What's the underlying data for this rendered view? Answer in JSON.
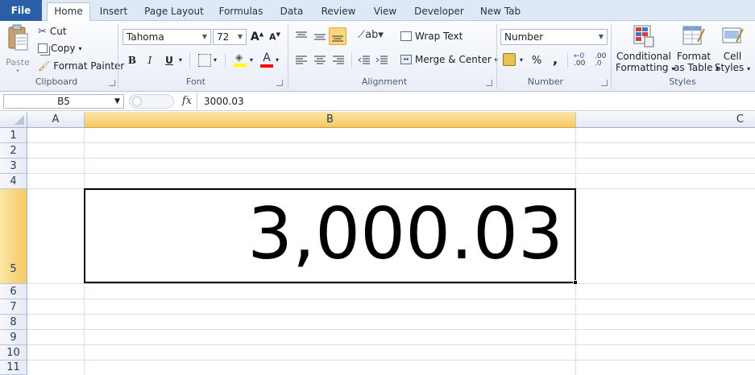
{
  "tabs": {
    "file": "File",
    "items": [
      "Home",
      "Insert",
      "Page Layout",
      "Formulas",
      "Data",
      "Review",
      "View",
      "Developer",
      "New Tab"
    ]
  },
  "clipboard": {
    "paste": "Paste",
    "cut": "Cut",
    "copy": "Copy",
    "format_painter": "Format Painter",
    "group_label": "Clipboard"
  },
  "font": {
    "name": "Tahoma",
    "size": "72",
    "bold": "B",
    "italic": "I",
    "underline": "U",
    "font_color_letter": "A",
    "group_label": "Font"
  },
  "alignment": {
    "wrap_text": "Wrap Text",
    "merge_center": "Merge & Center",
    "group_label": "Alignment"
  },
  "number": {
    "format": "Number",
    "percent": "%",
    "comma": ",",
    "inc_decimal": ".00",
    "dec_decimal": ".0",
    "group_label": "Number"
  },
  "styles": {
    "conditional_1": "Conditional",
    "conditional_2": "Formatting",
    "format_table_1": "Format",
    "format_table_2": "as Table",
    "cell_styles_1": "Cell",
    "cell_styles_2": "Styles",
    "group_label": "Styles"
  },
  "formula_bar": {
    "name_box": "B5",
    "fx": "fx",
    "value": "3000.03"
  },
  "grid": {
    "columns": [
      "A",
      "B",
      "C"
    ],
    "rows": [
      "1",
      "2",
      "3",
      "4",
      "5",
      "6",
      "7",
      "8",
      "9",
      "10",
      "11"
    ],
    "active_cell_display": "3,000.03"
  },
  "colors": {
    "file_tab": "#2a5fa8",
    "selected_header": "#f5c964",
    "font_highlight": "#ffff00",
    "font_color": "#ff0000"
  }
}
